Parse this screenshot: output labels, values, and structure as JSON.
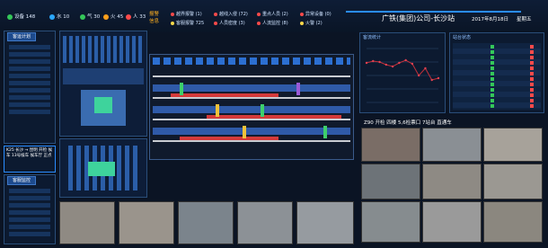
{
  "header": {
    "title": "广铁(集团)公司-长沙站",
    "date": "2017年8月18日",
    "weekday": "星期五",
    "stats": [
      {
        "icon": "power-icon",
        "color": "#34c759",
        "value": "设备  148"
      },
      {
        "icon": "water-icon",
        "color": "#2aa7ff",
        "value": "水  10"
      },
      {
        "icon": "gas-icon",
        "color": "#34c759",
        "value": "气  30"
      },
      {
        "icon": "fire-icon",
        "color": "#ff9f1a",
        "value": "火  45"
      },
      {
        "icon": "alert-icon",
        "color": "#ff4a4a",
        "value": "人  33"
      }
    ],
    "alarm_label": "报警\n信息",
    "alarms": [
      {
        "color": "#ff4a4a",
        "text": "越界报警 (1)"
      },
      {
        "color": "#ff4a4a",
        "text": "越线入侵 (72)"
      },
      {
        "color": "#ff4a4a",
        "text": "重点人员 (2)"
      },
      {
        "color": "#ff4a4a",
        "text": "异常设备 (0)"
      },
      {
        "color": "#ffd84a",
        "text": "客服报警 725"
      },
      {
        "color": "#ff4a4a",
        "text": "人员密度 (3)"
      },
      {
        "color": "#ff4a4a",
        "text": "人流监控 (8)"
      },
      {
        "color": "#ffd84a",
        "text": "火警 (2)"
      }
    ]
  },
  "left": {
    "title1": "客运计划",
    "info": "K25 长沙 → 昆明 开检 候车 13号候车 候车厅 正点",
    "info2": "K9068 正点 已检",
    "title2": "客服监控"
  },
  "right": {
    "chart_title": "客流统计",
    "table_title": "站台状态",
    "train_label": "Z90  开检  四楼  5,6检票口 7站台  直通车"
  },
  "chart_data": {
    "type": "line",
    "x": [
      1,
      2,
      3,
      4,
      5,
      6,
      7,
      8,
      9,
      10,
      11,
      12
    ],
    "values": [
      44,
      46,
      45,
      42,
      40,
      44,
      47,
      43,
      30,
      38,
      25,
      27
    ],
    "ylim": [
      0,
      60
    ],
    "xlabel": "",
    "ylabel": ""
  }
}
